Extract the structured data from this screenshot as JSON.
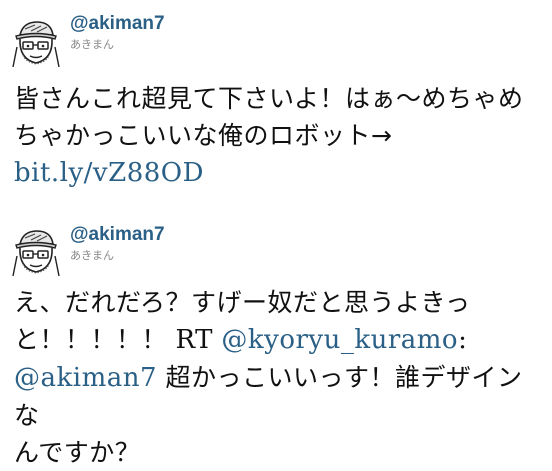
{
  "tweets": [
    {
      "username": "@akiman7",
      "display_name": "あきまん",
      "line1": "皆さんこれ超見て下さいよ！はぁ〜めちゃめ",
      "line2": "ちゃかっこいいな俺のロボット→",
      "link": "bit.ly/vZ88OD"
    },
    {
      "username": "@akiman7",
      "display_name": "あきまん",
      "line1": "え、だれだろ？すげー奴だと思うよきっ",
      "line2_text": "と！！！！！ ",
      "rt": "RT",
      "mention1": "@kyoryu_kuramo",
      "colon": ":",
      "mention2": "@akiman7",
      "line3_text": " 超かっこいいっす！誰デザインな",
      "line4": "んですか？"
    }
  ]
}
